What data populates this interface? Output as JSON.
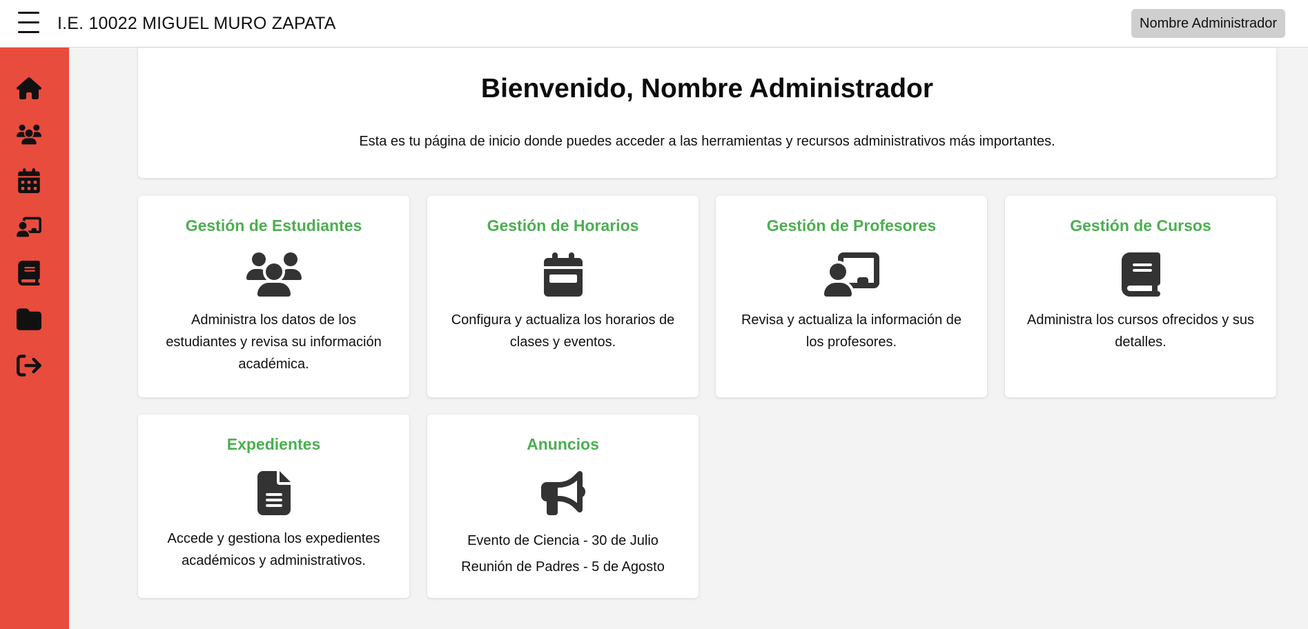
{
  "header": {
    "title": "I.E. 10022 MIGUEL MURO ZAPATA",
    "user_button": "Nombre Administrador"
  },
  "sidebar": {
    "items": [
      {
        "icon": "home-icon"
      },
      {
        "icon": "users-icon"
      },
      {
        "icon": "calendar-icon"
      },
      {
        "icon": "teacher-icon"
      },
      {
        "icon": "book-icon"
      },
      {
        "icon": "folder-icon"
      },
      {
        "icon": "logout-icon"
      }
    ]
  },
  "welcome": {
    "title": "Bienvenido, Nombre Administrador",
    "text": "Esta es tu página de inicio donde puedes acceder a las herramientas y recursos administrativos más importantes."
  },
  "cards": [
    {
      "title": "Gestión de Estudiantes",
      "icon": "users-icon",
      "text": "Administra los datos de los estudiantes y revisa su información académica."
    },
    {
      "title": "Gestión de Horarios",
      "icon": "calendar-icon",
      "text": "Configura y actualiza los horarios de clases y eventos."
    },
    {
      "title": "Gestión de Profesores",
      "icon": "teacher-icon",
      "text": "Revisa y actualiza la información de los profesores."
    },
    {
      "title": "Gestión de Cursos",
      "icon": "book-icon",
      "text": "Administra los cursos ofrecidos y sus detalles."
    },
    {
      "title": "Expedientes",
      "icon": "file-icon",
      "text": "Accede y gestiona los expedientes académicos y administrativos."
    },
    {
      "title": "Anuncios",
      "icon": "megaphone-icon",
      "announcements": [
        "Evento de Ciencia - 30 de Julio",
        "Reunión de Padres - 5 de Agosto"
      ]
    }
  ],
  "colors": {
    "sidebar": "#e84c3d",
    "card_title": "#4caf50",
    "background": "#f3f3f3"
  }
}
